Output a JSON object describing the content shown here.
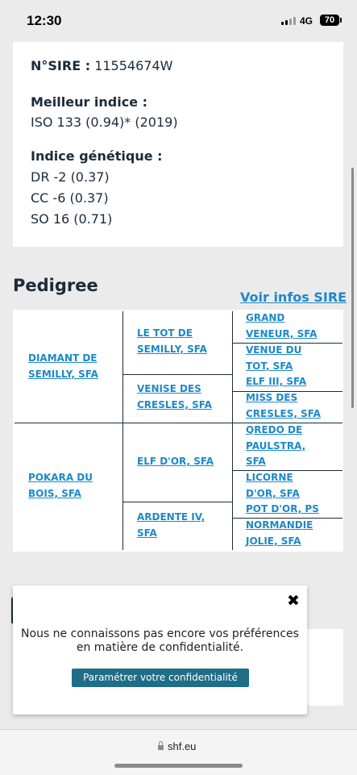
{
  "status_bar": {
    "time": "12:30",
    "network": "4G",
    "battery": "70"
  },
  "info": {
    "sire_label": "N°SIRE :",
    "sire_value": "11554674W",
    "best_index_title": "Meilleur indice :",
    "best_index_value": "ISO 133 (0.94)* (2019)",
    "genetic_title": "Indice génétique :",
    "genetic_lines": [
      "DR -2 (0.37)",
      "CC -6 (0.37)",
      "SO 16 (0.71)"
    ]
  },
  "pedigree": {
    "title": "Pedigree",
    "sire_link": "Voir infos SIRE",
    "parents": [
      [
        "DIAMANT DE",
        "SEMILLY, SFA"
      ],
      [
        "POKARA DU",
        "BOIS, SFA"
      ]
    ],
    "grandparents": [
      [
        "LE TOT DE",
        "SEMILLY, SFA"
      ],
      [
        "VENISE DES",
        "CRESLES, SFA"
      ],
      [
        "ELF D'OR, SFA"
      ],
      [
        "ARDENTE IV,",
        "SFA"
      ]
    ],
    "great_grandparents": [
      [
        "GRAND",
        "VENEUR, SFA"
      ],
      [
        "VENUE DU",
        "TOT, SFA"
      ],
      [
        "ELF III, SFA"
      ],
      [
        "MISS DES",
        "CRESLES, SFA"
      ],
      [
        "QREDO DE",
        "PAULSTRA,",
        "SFA"
      ],
      [
        "LICORNE",
        "D'OR, SFA"
      ],
      [
        "POT D'OR, PS"
      ],
      [
        "NORMANDIE",
        "JOLIE, SFA"
      ]
    ]
  },
  "consent": {
    "message_line1": "Nous ne connaissons pas encore vos préférences",
    "message_line2": "en matière de confidentialité.",
    "button_label": "Paramétrer votre confidentialité"
  },
  "browser": {
    "url": "shf.eu"
  }
}
